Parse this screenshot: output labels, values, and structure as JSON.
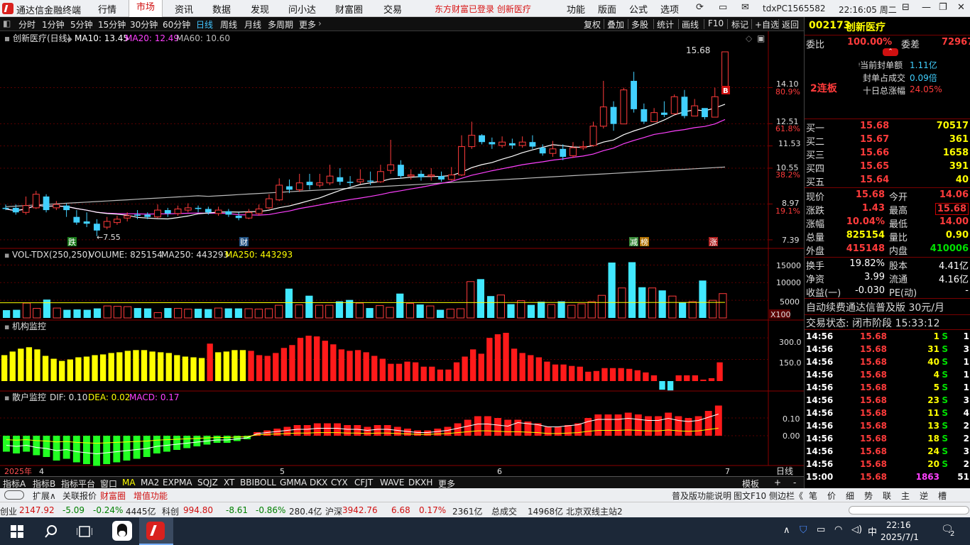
{
  "app": {
    "title": "通达信金融终端",
    "login_notice": "东方财富已登录 创新医疗",
    "session_id": "tdxPC1565582",
    "clock": "22:16:05 周二"
  },
  "menu": [
    "行情",
    "市场",
    "资讯",
    "数据",
    "发现",
    "问小达",
    "财富圈",
    "交易"
  ],
  "menu_active": "市场",
  "menu_right": [
    "功能",
    "版面",
    "公式",
    "选项"
  ],
  "periods": [
    "分时",
    "1分钟",
    "5分钟",
    "15分钟",
    "30分钟",
    "60分钟",
    "日线",
    "周线",
    "月线",
    "多周期",
    "更多"
  ],
  "period_active": "日线",
  "toolbar_right": [
    "复权",
    "叠加",
    "多股",
    "统计",
    "画线",
    "F10",
    "标记",
    "+自选",
    "返回"
  ],
  "chart": {
    "title": "创新医疗(日线)",
    "ma10": "MA10: 13.45",
    "ma20": "MA20: 12.49",
    "ma60": "MA60: 10.60",
    "price_axis": [
      "15.68",
      "14.10",
      "12.51",
      "11.53",
      "10.55",
      "8.97",
      "7.39"
    ],
    "pct_axis": [
      "80.9%",
      "61.8%",
      "38.2%",
      "19.1%"
    ],
    "high_label": "15.68",
    "low_label": "7.55",
    "markers": [
      "跌",
      "财",
      "减",
      "榜",
      "涨"
    ],
    "buy_marker": "B",
    "vol_header": "VOL-TDX(250,250)",
    "vol_value": "VOLUME: 825154",
    "vol_ma1": "MA250: 443293",
    "vol_ma2": "MA250: 443293",
    "vol_axis": [
      "15000",
      "10000",
      "5000",
      "X100"
    ],
    "inst_header": "机构监控",
    "inst_axis": [
      "300.0",
      "150.0"
    ],
    "retail_header": "散户监控",
    "dif": "DIF: 0.10",
    "dea": "DEA: 0.02",
    "macd": "MACD: 0.17",
    "macd_axis": [
      "0.10",
      "0.00"
    ],
    "time_axis": [
      "2025年",
      "4",
      "5",
      "6",
      "7"
    ],
    "period_label": "日线"
  },
  "chart_data": {
    "type": "candlestick",
    "title": "创新医疗(日线)",
    "close_last": 15.68,
    "high": 15.68,
    "low": 7.55,
    "ylim": [
      7.39,
      15.68
    ],
    "candles": [
      [
        8.8,
        8.75,
        8.95,
        8.7
      ],
      [
        8.8,
        8.6,
        8.95,
        8.5
      ],
      [
        8.6,
        8.9,
        9.3,
        8.5
      ],
      [
        8.8,
        9.4,
        9.55,
        8.75
      ],
      [
        9.3,
        8.7,
        9.4,
        8.6
      ],
      [
        8.8,
        8.95,
        9.1,
        8.7
      ],
      [
        8.9,
        8.7,
        9.0,
        8.4
      ],
      [
        8.4,
        8.15,
        8.7,
        8.05
      ],
      [
        8.2,
        8.1,
        8.6,
        7.95
      ],
      [
        8.1,
        7.8,
        8.3,
        7.55
      ],
      [
        7.95,
        8.2,
        8.4,
        7.85
      ],
      [
        8.15,
        8.3,
        8.45,
        8.05
      ],
      [
        8.35,
        8.45,
        8.6,
        8.2
      ],
      [
        8.5,
        8.45,
        8.7,
        8.3
      ],
      [
        8.5,
        8.4,
        8.6,
        8.3
      ],
      [
        8.4,
        8.7,
        8.95,
        8.35
      ],
      [
        8.7,
        8.55,
        8.8,
        8.4
      ],
      [
        8.55,
        8.75,
        8.9,
        8.45
      ],
      [
        8.7,
        8.8,
        9.0,
        8.6
      ],
      [
        8.8,
        8.75,
        8.9,
        8.6
      ],
      [
        8.75,
        8.6,
        8.85,
        8.5
      ],
      [
        8.55,
        8.7,
        8.85,
        8.45
      ],
      [
        8.65,
        8.5,
        8.75,
        8.4
      ],
      [
        8.45,
        8.35,
        8.6,
        8.25
      ],
      [
        8.35,
        8.6,
        8.75,
        8.3
      ],
      [
        8.55,
        8.75,
        8.95,
        8.45
      ],
      [
        8.8,
        9.2,
        9.4,
        8.75
      ],
      [
        9.15,
        9.8,
        10.1,
        9.1
      ],
      [
        9.75,
        9.6,
        10.05,
        9.45
      ],
      [
        9.6,
        9.9,
        10.3,
        9.5
      ],
      [
        9.95,
        9.8,
        10.3,
        9.6
      ],
      [
        9.8,
        9.9,
        10.3,
        9.7
      ],
      [
        9.9,
        10.2,
        10.7,
        9.8
      ],
      [
        10.15,
        9.95,
        10.55,
        9.8
      ],
      [
        9.95,
        9.9,
        10.2,
        9.75
      ],
      [
        9.95,
        10.05,
        10.5,
        9.85
      ],
      [
        10.0,
        9.95,
        10.4,
        9.8
      ],
      [
        9.95,
        10.4,
        10.7,
        9.9
      ],
      [
        10.45,
        10.7,
        11.8,
        10.3
      ],
      [
        10.7,
        10.2,
        10.9,
        10.1
      ],
      [
        10.2,
        10.25,
        10.5,
        10.05
      ],
      [
        10.3,
        10.15,
        10.45,
        10.0
      ],
      [
        10.2,
        10.25,
        10.55,
        10.0
      ],
      [
        10.2,
        10.05,
        10.4,
        9.95
      ],
      [
        10.05,
        10.25,
        10.6,
        10.0
      ],
      [
        10.25,
        11.5,
        12.0,
        10.2
      ],
      [
        11.5,
        12.0,
        12.6,
        11.4
      ],
      [
        12.0,
        11.7,
        12.05,
        11.6
      ],
      [
        11.7,
        11.6,
        11.9,
        11.4
      ],
      [
        11.55,
        11.7,
        11.95,
        11.45
      ],
      [
        11.65,
        11.55,
        11.85,
        11.4
      ],
      [
        11.55,
        11.7,
        11.95,
        11.45
      ],
      [
        11.7,
        11.5,
        12.0,
        11.4
      ],
      [
        11.45,
        11.2,
        11.6,
        11.1
      ],
      [
        11.2,
        11.4,
        11.75,
        11.05
      ],
      [
        11.4,
        11.05,
        11.6,
        10.9
      ],
      [
        11.1,
        11.45,
        11.7,
        11.0
      ],
      [
        11.45,
        11.5,
        11.75,
        11.35
      ],
      [
        11.55,
        12.4,
        12.6,
        11.5
      ],
      [
        12.4,
        13.25,
        14.4,
        12.3
      ],
      [
        13.25,
        12.5,
        13.5,
        12.2
      ],
      [
        12.5,
        14.0,
        14.1,
        12.5
      ],
      [
        14.4,
        13.15,
        14.8,
        13.0
      ],
      [
        13.15,
        12.6,
        13.4,
        12.5
      ],
      [
        12.6,
        13.0,
        13.2,
        12.6
      ],
      [
        13.0,
        12.9,
        13.5,
        12.8
      ],
      [
        12.95,
        13.7,
        13.8,
        12.9
      ],
      [
        13.7,
        12.85,
        14.0,
        12.75
      ],
      [
        12.85,
        13.3,
        13.6,
        12.85
      ],
      [
        13.2,
        12.8,
        13.0,
        12.7
      ],
      [
        12.8,
        13.7,
        14.1,
        12.8
      ],
      [
        14.1,
        15.68,
        15.68,
        14.1
      ]
    ],
    "ma10_last": 13.45,
    "ma20_last": 12.49,
    "ma60_last": 10.6,
    "volume": [
      2200,
      2300,
      4200,
      2700,
      5200,
      2800,
      2300,
      2400,
      2300,
      2700,
      3400,
      3300,
      3200,
      2800,
      2700,
      1500,
      2800,
      2700,
      2500,
      2600,
      2500,
      2800,
      2700,
      2700,
      2600,
      2500,
      2600,
      3600,
      8300,
      3700,
      6300,
      3600,
      3600,
      4700,
      5100,
      4200,
      2800,
      3500,
      3000,
      6900,
      4100,
      3800,
      3400,
      2300,
      2500,
      2600,
      10300,
      11000,
      6200,
      6500,
      3900,
      4900,
      3700,
      4600,
      3800,
      4700,
      3600,
      4000,
      4600,
      6400,
      15700,
      8500,
      15800,
      8700,
      8500,
      7800,
      6200,
      4400,
      4600,
      10600,
      5000,
      6900
    ],
    "institution": [
      180,
      205,
      225,
      235,
      220,
      175,
      155,
      140,
      150,
      165,
      170,
      180,
      185,
      195,
      200,
      210,
      215,
      215,
      205,
      200,
      195,
      180,
      170,
      165,
      160,
      260,
      200,
      205,
      215,
      215,
      210,
      180,
      175,
      195,
      230,
      250,
      300,
      315,
      310,
      280,
      255,
      220,
      210,
      215,
      200,
      175,
      155,
      120,
      120,
      135,
      130,
      100,
      100,
      80,
      80,
      130,
      170,
      220,
      190,
      300,
      325,
      335,
      225,
      195,
      180,
      165,
      135,
      115,
      115,
      105,
      100,
      65,
      70,
      90,
      90,
      90,
      85,
      75,
      60,
      40,
      -60,
      -65,
      40,
      40,
      40,
      10,
      20,
      130
    ],
    "macd": [
      -0.09,
      -0.1,
      -0.09,
      -0.11,
      -0.12,
      -0.14,
      -0.13,
      -0.15,
      -0.16,
      -0.17,
      -0.16,
      -0.15,
      -0.14,
      -0.13,
      -0.12,
      -0.1,
      -0.09,
      -0.08,
      -0.07,
      -0.06,
      -0.05,
      -0.04,
      -0.04,
      -0.03,
      -0.02,
      0.02,
      0.03,
      0.04,
      0.05,
      0.06,
      0.06,
      0.07,
      0.07,
      0.07,
      0.06,
      0.06,
      0.05,
      0.06,
      0.06,
      0.05,
      0.04,
      0.03,
      0.03,
      0.04,
      0.05,
      0.07,
      0.09,
      0.11,
      0.11,
      0.1,
      0.09,
      0.09,
      0.08,
      0.07,
      0.05,
      0.05,
      0.06,
      0.07,
      0.1,
      0.12,
      0.12,
      0.12,
      0.13,
      0.12,
      0.11,
      0.11,
      0.13,
      0.11,
      0.1,
      0.11,
      0.14,
      0.17
    ]
  },
  "right": {
    "code": "002173",
    "name": "创新医疗",
    "weibi_label": "委比",
    "weibi": "100.00%",
    "weicha_label": "委差",
    "weicha": "72967",
    "seal_amount_label": "当前封单额",
    "seal_amount": "1.11亿",
    "seal_ratio_label": "封单占成交",
    "seal_ratio": "0.09倍",
    "ten_day_label": "十日总涨幅",
    "ten_day": "24.05%",
    "streak": "2连板",
    "bids": [
      {
        "label": "买一",
        "price": "15.68",
        "vol": "70517"
      },
      {
        "label": "买二",
        "price": "15.67",
        "vol": "361"
      },
      {
        "label": "买三",
        "price": "15.66",
        "vol": "1658"
      },
      {
        "label": "买四",
        "price": "15.65",
        "vol": "391"
      },
      {
        "label": "买五",
        "price": "15.64",
        "vol": "40"
      }
    ],
    "quote": [
      {
        "l1": "现价",
        "v1": "15.68",
        "l2": "今开",
        "v2": "14.06"
      },
      {
        "l1": "涨跌",
        "v1": "1.43",
        "l2": "最高",
        "v2": "15.68"
      },
      {
        "l1": "涨幅",
        "v1": "10.04%",
        "l2": "最低",
        "v2": "14.00"
      },
      {
        "l1": "总量",
        "v1": "825154",
        "l2": "量比",
        "v2": "0.90"
      },
      {
        "l1": "外盘",
        "v1": "415148",
        "l2": "内盘",
        "v2": "410006"
      }
    ],
    "fundamentals": [
      {
        "l1": "换手",
        "v1": "19.82%",
        "l2": "股本",
        "v2": "4.41亿"
      },
      {
        "l1": "净资",
        "v1": "3.99",
        "l2": "流通",
        "v2": "4.16亿"
      },
      {
        "l1": "收益(一)",
        "v1": "-0.030",
        "l2": "PE(动)",
        "v2": "-"
      }
    ],
    "promo": "自动续费通达信普及版 30元/月",
    "trade_status": "交易状态: 闭市阶段 15:33:12",
    "ticks": [
      {
        "t": "14:56",
        "p": "15.68",
        "v": "1",
        "s": "S",
        "n": "1"
      },
      {
        "t": "14:56",
        "p": "15.68",
        "v": "31",
        "s": "S",
        "n": "3"
      },
      {
        "t": "14:56",
        "p": "15.68",
        "v": "40",
        "s": "S",
        "n": "1"
      },
      {
        "t": "14:56",
        "p": "15.68",
        "v": "4",
        "s": "S",
        "n": "1"
      },
      {
        "t": "14:56",
        "p": "15.68",
        "v": "5",
        "s": "S",
        "n": "1"
      },
      {
        "t": "14:56",
        "p": "15.68",
        "v": "23",
        "s": "S",
        "n": "3"
      },
      {
        "t": "14:56",
        "p": "15.68",
        "v": "11",
        "s": "S",
        "n": "4"
      },
      {
        "t": "14:56",
        "p": "15.68",
        "v": "13",
        "s": "S",
        "n": "2"
      },
      {
        "t": "14:56",
        "p": "15.68",
        "v": "18",
        "s": "S",
        "n": "2"
      },
      {
        "t": "14:56",
        "p": "15.68",
        "v": "24",
        "s": "S",
        "n": "3"
      },
      {
        "t": "14:56",
        "p": "15.68",
        "v": "20",
        "s": "S",
        "n": "2"
      },
      {
        "t": "15:00",
        "p": "15.68",
        "v": "1863",
        "s": "",
        "n": "51"
      }
    ]
  },
  "bottom_tabs": [
    "指标A",
    "指标B",
    "指标平台",
    "窗口",
    "MA",
    "MA2",
    "EXPMA",
    "SQJZ",
    "XT",
    "BBIBOLL",
    "GMMA",
    "DKX",
    "CYX",
    "CFJT",
    "WAVE",
    "DKXH",
    "更多"
  ],
  "bottom_right": [
    "模板",
    "+",
    "-"
  ],
  "bottom2": [
    "扩展∧",
    "关联报价",
    "财富圈",
    "增值功能"
  ],
  "bottom2_right": [
    "普及版功能说明",
    "图文F10",
    "侧边栏《"
  ],
  "right_tabs": [
    "笔",
    "价",
    "细",
    "势",
    "联",
    "主",
    "逆",
    "槽"
  ],
  "status": {
    "cy_label": "创业",
    "cy": "2147.92",
    "cy_chg": "-5.09",
    "cy_pct": "-0.24%",
    "cy_amt": "4445亿",
    "kc_label": "科创",
    "kc": "994.80",
    "kc_chg": "-8.61",
    "kc_pct": "-0.86%",
    "kc_amt": "280.4亿",
    "hs_label": "沪深",
    "hs": "3942.76",
    "hs_chg": "6.68",
    "hs_pct": "0.17%",
    "hs_amt": "2361亿",
    "total_label": "总成交",
    "total": "14968亿",
    "server": "北京双线主站2"
  },
  "taskbar": {
    "time": "22:16",
    "date": "2025/7/1",
    "ime": "中",
    "notif": "2"
  }
}
